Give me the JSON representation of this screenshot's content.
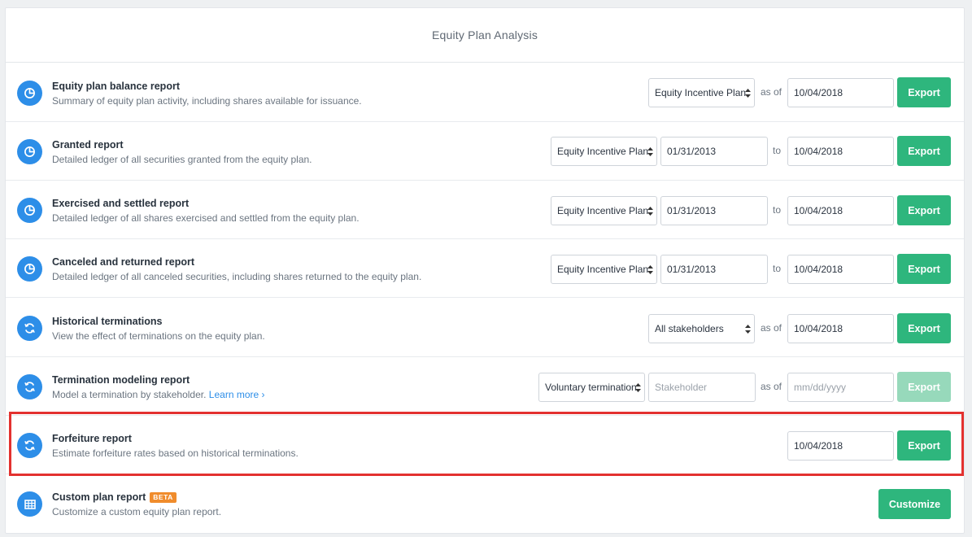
{
  "header": {
    "title": "Equity Plan Analysis"
  },
  "rows": [
    {
      "title": "Equity plan balance report",
      "description": "Summary of equity plan activity, including shares available for issuance.",
      "icon": "pie-chart-icon",
      "plan_select": "Equity Incentive Plan",
      "connector": "as of",
      "date": "10/04/2018",
      "button": "Export"
    },
    {
      "title": "Granted report",
      "description": "Detailed ledger of all securities granted from the equity plan.",
      "icon": "pie-chart-icon",
      "plan_select": "Equity Incentive Plan",
      "start_date": "01/31/2013",
      "connector": "to",
      "date": "10/04/2018",
      "button": "Export"
    },
    {
      "title": "Exercised and settled report",
      "description": "Detailed ledger of all shares exercised and settled from the equity plan.",
      "icon": "pie-chart-icon",
      "plan_select": "Equity Incentive Plan",
      "start_date": "01/31/2013",
      "connector": "to",
      "date": "10/04/2018",
      "button": "Export"
    },
    {
      "title": "Canceled and returned report",
      "description": "Detailed ledger of all canceled securities, including shares returned to the equity plan.",
      "icon": "pie-chart-icon",
      "plan_select": "Equity Incentive Plan",
      "start_date": "01/31/2013",
      "connector": "to",
      "date": "10/04/2018",
      "button": "Export"
    },
    {
      "title": "Historical terminations",
      "description": "View the effect of terminations on the equity plan.",
      "icon": "refresh-icon",
      "stakeholder_select": "All stakeholders",
      "connector": "as of",
      "date": "10/04/2018",
      "button": "Export"
    },
    {
      "title": "Termination modeling report",
      "description": "Model a termination by stakeholder.",
      "learn_more": "Learn more ›",
      "icon": "refresh-icon",
      "termination_select": "Voluntary termination",
      "stakeholder_placeholder": "Stakeholder",
      "connector": "as of",
      "date_placeholder": "mm/dd/yyyy",
      "button": "Export",
      "button_disabled": true
    },
    {
      "title": "Forfeiture report",
      "description": "Estimate forfeiture rates based on historical terminations.",
      "icon": "refresh-icon",
      "date": "10/04/2018",
      "button": "Export",
      "highlighted": true
    },
    {
      "title": "Custom plan report",
      "badge": "BETA",
      "description": "Customize a custom equity plan report.",
      "icon": "table-icon",
      "button": "Customize"
    }
  ],
  "colors": {
    "accent_blue": "#2d8ee8",
    "export_green": "#2eb67d",
    "export_green_disabled": "#97d9bb",
    "beta_orange": "#f08c2c",
    "highlight_red": "#e3312f"
  }
}
